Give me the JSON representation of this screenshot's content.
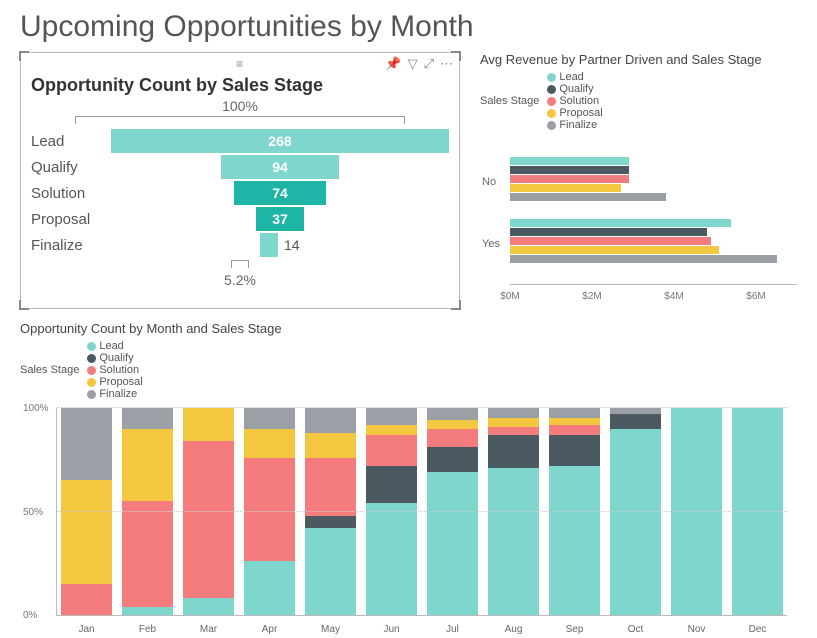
{
  "page_title": "Upcoming Opportunities by Month",
  "colors": {
    "lead": "#7ed6cc",
    "lead_dark": "#1fb5a6",
    "qualify": "#4a5a60",
    "solution": "#f47c7c",
    "proposal": "#f3c73f",
    "finalize": "#9aa0a6"
  },
  "funnel": {
    "title": "Opportunity Count by Sales Stage",
    "top_pct": "100%",
    "bottom_pct": "5.2%",
    "rows": [
      {
        "label": "Lead",
        "value": 268,
        "width_pct": 100,
        "color": "#7ed6cc",
        "inside": true
      },
      {
        "label": "Qualify",
        "value": 94,
        "width_pct": 35,
        "color": "#7ed6cc",
        "inside": true
      },
      {
        "label": "Solution",
        "value": 74,
        "width_pct": 27,
        "color": "#1fb5a6",
        "inside": true
      },
      {
        "label": "Proposal",
        "value": 37,
        "width_pct": 14,
        "color": "#1fb5a6",
        "inside": true
      },
      {
        "label": "Finalize",
        "value": 14,
        "width_pct": 5.2,
        "color": "#7ed6cc",
        "inside": false
      }
    ]
  },
  "revenue": {
    "title": "Avg Revenue by Partner Driven and Sales Stage",
    "legend_label": "Sales Stage",
    "legend": [
      {
        "name": "Lead",
        "color": "#7ed6cc"
      },
      {
        "name": "Qualify",
        "color": "#4a5a60"
      },
      {
        "name": "Solution",
        "color": "#f47c7c"
      },
      {
        "name": "Proposal",
        "color": "#f3c73f"
      },
      {
        "name": "Finalize",
        "color": "#9aa0a6"
      }
    ],
    "categories": [
      "No",
      "Yes"
    ],
    "ticks": [
      "$0M",
      "$2M",
      "$4M",
      "$6M"
    ],
    "max": 7
  },
  "stacked": {
    "title": "Opportunity Count by Month and Sales Stage",
    "legend_label": "Sales Stage",
    "legend": [
      {
        "name": "Lead",
        "color": "#7ed6cc"
      },
      {
        "name": "Qualify",
        "color": "#4a5a60"
      },
      {
        "name": "Solution",
        "color": "#f47c7c"
      },
      {
        "name": "Proposal",
        "color": "#f3c73f"
      },
      {
        "name": "Finalize",
        "color": "#9aa0a6"
      }
    ],
    "yticks": [
      "0%",
      "50%",
      "100%"
    ],
    "months": [
      "Jan",
      "Feb",
      "Mar",
      "Apr",
      "May",
      "Jun",
      "Jul",
      "Aug",
      "Sep",
      "Oct",
      "Nov",
      "Dec"
    ]
  },
  "chart_data": [
    {
      "type": "bar",
      "subtype": "funnel",
      "title": "Opportunity Count by Sales Stage",
      "categories": [
        "Lead",
        "Qualify",
        "Solution",
        "Proposal",
        "Finalize"
      ],
      "values": [
        268,
        94,
        74,
        37,
        14
      ],
      "top_pct": 100,
      "bottom_pct": 5.2
    },
    {
      "type": "bar",
      "subtype": "grouped-horizontal",
      "title": "Avg Revenue by Partner Driven and Sales Stage",
      "xlabel": "",
      "ylabel": "",
      "x_units": "$M",
      "xlim": [
        0,
        7
      ],
      "categories": [
        "No",
        "Yes"
      ],
      "series": [
        {
          "name": "Lead",
          "values": [
            2.9,
            5.4
          ]
        },
        {
          "name": "Qualify",
          "values": [
            2.9,
            4.8
          ]
        },
        {
          "name": "Solution",
          "values": [
            2.9,
            4.9
          ]
        },
        {
          "name": "Proposal",
          "values": [
            2.7,
            5.1
          ]
        },
        {
          "name": "Finalize",
          "values": [
            3.8,
            6.5
          ]
        }
      ]
    },
    {
      "type": "bar",
      "subtype": "stacked-100pct",
      "title": "Opportunity Count by Month and Sales Stage",
      "ylabel": "%",
      "ylim": [
        0,
        100
      ],
      "categories": [
        "Jan",
        "Feb",
        "Mar",
        "Apr",
        "May",
        "Jun",
        "Jul",
        "Aug",
        "Sep",
        "Oct",
        "Nov",
        "Dec"
      ],
      "series": [
        {
          "name": "Lead",
          "values": [
            0,
            4,
            8,
            26,
            42,
            54,
            69,
            71,
            72,
            90,
            100,
            100
          ]
        },
        {
          "name": "Qualify",
          "values": [
            0,
            0,
            0,
            0,
            6,
            18,
            12,
            16,
            15,
            7,
            0,
            0
          ]
        },
        {
          "name": "Solution",
          "values": [
            15,
            51,
            76,
            50,
            28,
            15,
            9,
            4,
            5,
            0,
            0,
            0
          ]
        },
        {
          "name": "Proposal",
          "values": [
            50,
            35,
            16,
            14,
            12,
            5,
            4,
            4,
            3,
            0,
            0,
            0
          ]
        },
        {
          "name": "Finalize",
          "values": [
            35,
            10,
            0,
            10,
            12,
            8,
            6,
            5,
            5,
            3,
            0,
            0
          ]
        }
      ]
    }
  ]
}
